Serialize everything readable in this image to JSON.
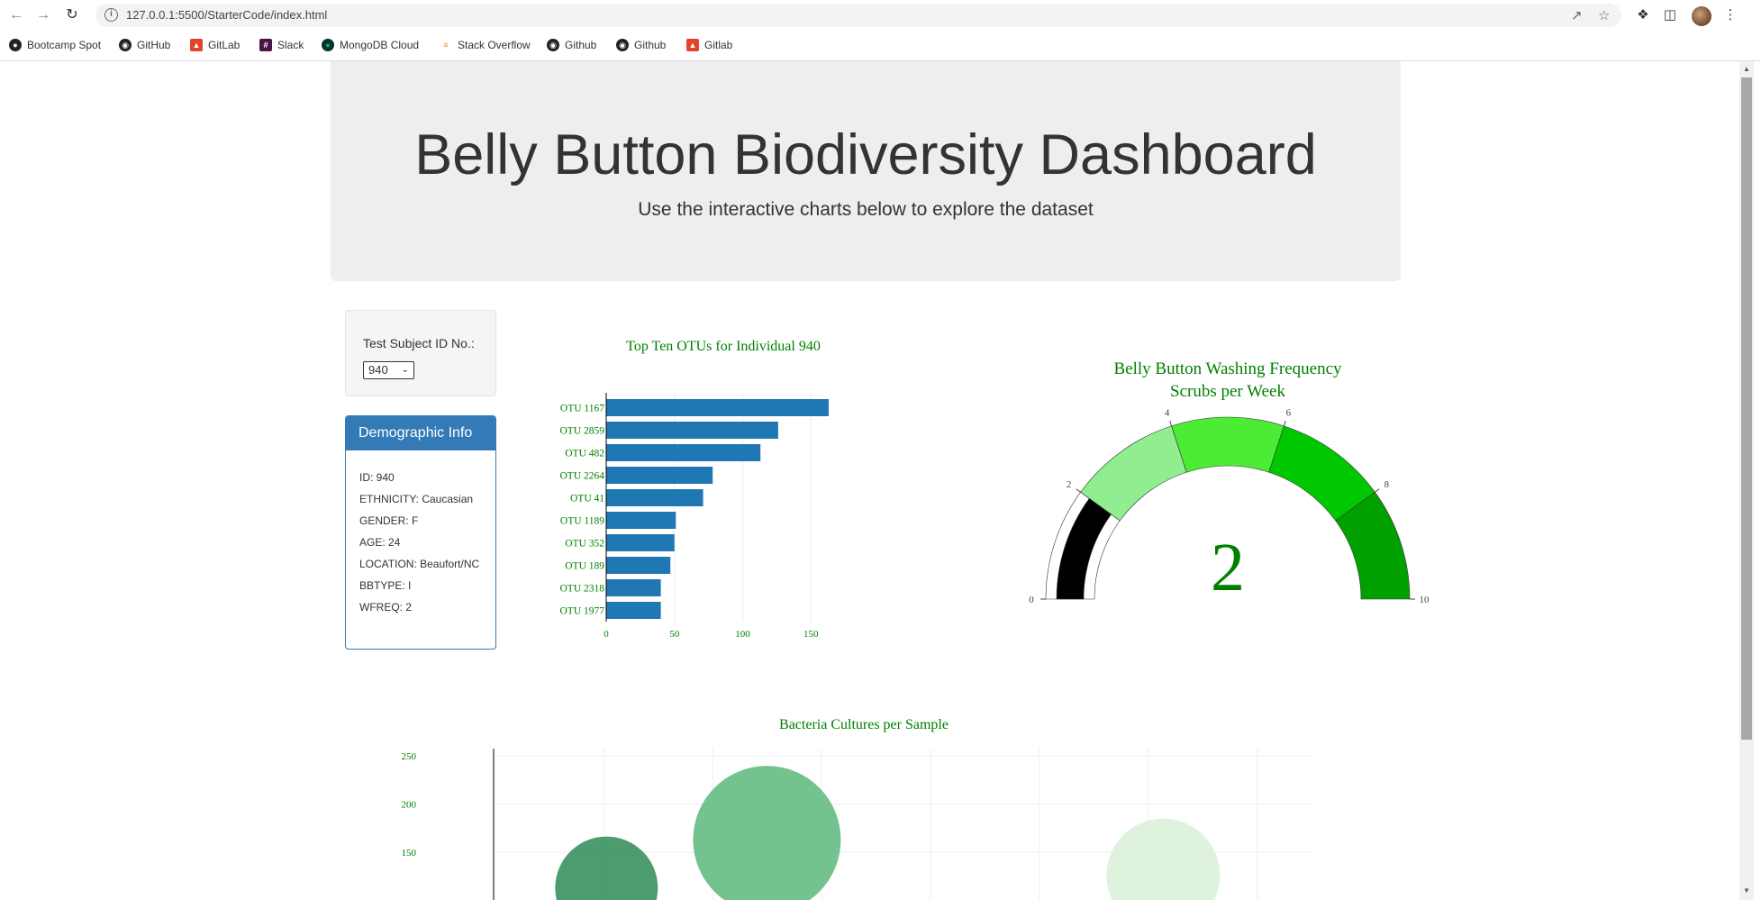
{
  "browser": {
    "url": "127.0.0.1:5500/StarterCode/index.html",
    "bookmarks": [
      {
        "label": "Bootcamp Spot",
        "icon": "bootcamp-icon"
      },
      {
        "label": "GitHub",
        "icon": "github-icon"
      },
      {
        "label": "GitLab",
        "icon": "gitlab-icon"
      },
      {
        "label": "Slack",
        "icon": "slack-icon"
      },
      {
        "label": "MongoDB Cloud",
        "icon": "mongodb-icon"
      },
      {
        "label": "Stack Overflow",
        "icon": "stackoverflow-icon"
      },
      {
        "label": "Github",
        "icon": "github-icon"
      },
      {
        "label": "Github",
        "icon": "github-icon"
      },
      {
        "label": "Gitlab",
        "icon": "gitlab-icon"
      }
    ]
  },
  "header": {
    "title": "Belly Button Biodiversity Dashboard",
    "subtitle": "Use the interactive charts below to explore the dataset"
  },
  "selector": {
    "label": "Test Subject ID No.:",
    "selected": "940"
  },
  "demographics": {
    "title": "Demographic Info",
    "rows": [
      "ID: 940",
      "ETHNICITY: Caucasian",
      "GENDER: F",
      "AGE: 24",
      "LOCATION: Beaufort/NC",
      "BBTYPE: I",
      "WFREQ: 2"
    ]
  },
  "colors": {
    "bar": "#1f77b4",
    "chart_text": "#008000",
    "gauge_steps": [
      "#ffffff",
      "#90ee90",
      "#4ceb34",
      "#00c800",
      "#00a000"
    ],
    "gauge_bar": "#000000"
  },
  "chart_data": [
    {
      "type": "bar",
      "orientation": "horizontal",
      "title": "Top Ten OTUs for Individual 940",
      "categories": [
        "OTU 1167",
        "OTU 2859",
        "OTU 482",
        "OTU 2264",
        "OTU 41",
        "OTU 1189",
        "OTU 352",
        "OTU 189",
        "OTU 2318",
        "OTU 1977"
      ],
      "values": [
        163,
        126,
        113,
        78,
        71,
        51,
        50,
        47,
        40,
        40
      ],
      "xticks": [
        "0",
        "50",
        "100",
        "150"
      ],
      "xlim": [
        0,
        165
      ]
    },
    {
      "type": "gauge",
      "title": "Belly Button Washing Frequency",
      "subtitle": "Scrubs per Week",
      "value": 2,
      "range": [
        0,
        10
      ],
      "ticks": [
        "0",
        "2",
        "4",
        "6",
        "8",
        "10"
      ],
      "steps": [
        [
          0,
          2
        ],
        [
          2,
          4
        ],
        [
          4,
          6
        ],
        [
          6,
          8
        ],
        [
          8,
          10
        ]
      ]
    },
    {
      "type": "scatter",
      "title": "Bacteria Cultures per Sample",
      "yticks": [
        "250",
        "200",
        "150"
      ],
      "visible_bubbles": [
        {
          "x": 482,
          "y": 113,
          "color": "#2e8b57"
        },
        {
          "x": 1167,
          "y": 163,
          "color": "#5cb87a"
        },
        {
          "x": 2859,
          "y": 126,
          "color": "#d8f0d8"
        }
      ]
    }
  ]
}
